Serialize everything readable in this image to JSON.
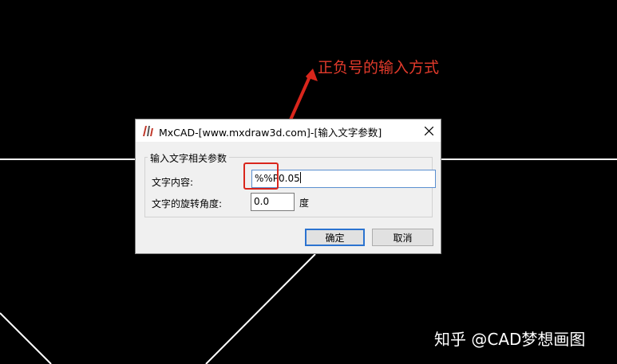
{
  "annotation": {
    "text": "正负号的输入方式",
    "color": "#e23a2b"
  },
  "watermark": {
    "text": "知乎 @CAD梦想画图"
  },
  "dialog": {
    "title": "MxCAD-[www.mxdraw3d.com]-[输入文字参数]",
    "close_glyph": "✕",
    "group_label": "输入文字相关参数",
    "fields": {
      "content_label": "文字内容:",
      "content_value": "%%P0.05",
      "angle_label": "文字的旋转角度:",
      "angle_value": "0.0",
      "angle_unit": "度"
    },
    "buttons": {
      "ok": "确定",
      "cancel": "取消"
    },
    "accent_color": "#2b73d0"
  },
  "icons": [
    "app-logo-icon",
    "close-icon"
  ]
}
